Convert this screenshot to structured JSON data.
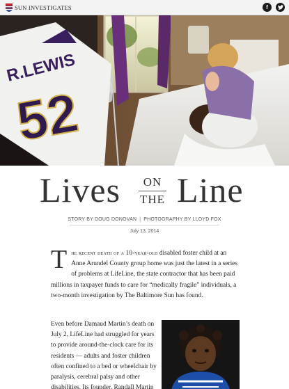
{
  "topbar": {
    "brand_name": "SUN INVESTIGATES",
    "logo_icon": "flag-logo-icon",
    "social": [
      {
        "name": "facebook-icon",
        "glyph": "f"
      },
      {
        "name": "twitter-icon",
        "glyph": "t"
      }
    ]
  },
  "hero": {
    "jersey_name": "R.LEWIS",
    "jersey_number": "52"
  },
  "headline": {
    "word1": "Lives",
    "word2": "ON",
    "word3": "THE",
    "word4": "Line"
  },
  "credits": {
    "story": "STORY BY DOUG DONOVAN",
    "separator": "|",
    "photo": "PHOTOGRAPHY BY LLOYD FOX",
    "date": "July 13, 2014"
  },
  "article": {
    "dropcap": "T",
    "lead_smallcaps": "he recent death of a 10-year-old",
    "para1_rest": " disabled foster child at an Anne Arundel County group home was just the latest in a series of problems at LifeLine, the state contractor that has been paid millions in taxpayer funds to care for “medically fragile” individuals, a two-month investigation by The Baltimore Sun has found.",
    "para2": "Even before Damaud Martin’s death on July 2, LifeLine had struggled for years to provide around-the-clock care for its residents — adults and foster children often confined to a bed or wheelchair by paralysis, cerebral palsy and other disabilities. Its founder, Randall Martin Jr., is"
  },
  "colors": {
    "topbar_bg": "#f3f3f3",
    "text": "#222222",
    "headline": "#333333",
    "social_bg": "#1b1b1b"
  }
}
